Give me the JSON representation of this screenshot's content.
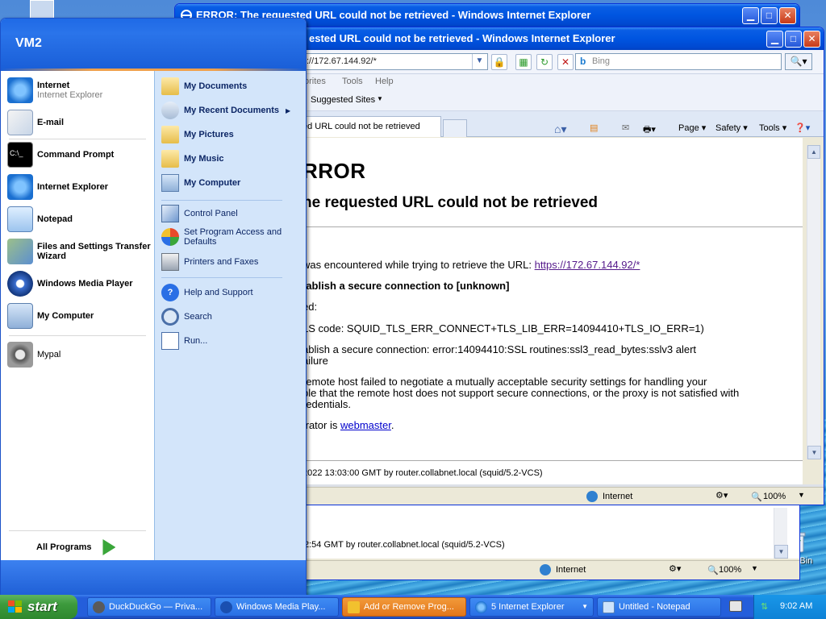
{
  "desktop": {
    "recycle_label": "ycle Bin"
  },
  "ie_back": {
    "title": "ERROR: The requested URL could not be retrieved - Windows Internet Explorer",
    "footer_line": "2:54 GMT by router.collabnet.local (squid/5.2-VCS)",
    "zone": "Internet",
    "zoom": "100%"
  },
  "ie_front": {
    "title": "ERROR: The requested URL could not be retrieved - Windows Internet Explorer",
    "title_visible": "ested URL could not be retrieved - Windows Internet Explorer",
    "address": "://172.67.144.92/*",
    "search_placeholder": "Bing",
    "menu": [
      "orites",
      "Tools",
      "Help"
    ],
    "favorites": {
      "suggested": "Suggested Sites"
    },
    "tab_label": "ed URL could not be retrieved",
    "commands": {
      "page": "Page",
      "safety": "Safety",
      "tools": "Tools"
    },
    "page": {
      "h1": "RROR",
      "h2": "he requested URL could not be retrieved",
      "p1_prefix": " was encountered while trying to retrieve the URL: ",
      "p1_link": "https://172.67.144.92/*",
      "p2": "tablish a secure connection to [unknown]",
      "p3": "ed:",
      "p4": "LS code: SQUID_TLS_ERR_CONNECT+TLS_LIB_ERR=14094410+TLS_IO_ERR=1)",
      "p5a": "ablish a secure connection: error:14094410:SSL routines:ssl3_read_bytes:sslv3 alert",
      "p5b": "ailure",
      "p6a": "remote host failed to negotiate a mutually acceptable security settings for handling your",
      "p6b": "ble that the remote host does not support secure connections, or the proxy is not satisfied with",
      "p6c": "redentials.",
      "p7_prefix": "trator is ",
      "p7_link": "webmaster",
      "p7_suffix": ".",
      "footer_line": "2022 13:03:00 GMT by router.collabnet.local (squid/5.2-VCS)"
    },
    "zone": "Internet",
    "zoom": "100%"
  },
  "start_menu": {
    "user": "VM2",
    "pinned": [
      {
        "title": "Internet",
        "subtitle": "Internet Explorer"
      },
      {
        "title": "E-mail",
        "subtitle": ""
      }
    ],
    "recent": [
      "Command Prompt",
      "Internet Explorer",
      "Notepad",
      "Files and Settings Transfer Wizard",
      "Windows Media Player",
      "My Computer"
    ],
    "other": "Mypal",
    "all_programs": "All Programs",
    "right": {
      "my_documents": "My Documents",
      "my_recent_documents": "My Recent Documents",
      "my_pictures": "My Pictures",
      "my_music": "My Music",
      "my_computer": "My Computer",
      "control_panel": "Control Panel",
      "set_program_access": "Set Program Access and Defaults",
      "printers_faxes": "Printers and Faxes",
      "help_support": "Help and Support",
      "search": "Search",
      "run": "Run..."
    }
  },
  "taskbar": {
    "start": "start",
    "buttons": [
      "DuckDuckGo — Priva...",
      "Windows Media Play...",
      "Add or Remove Prog...",
      "5 Internet Explorer",
      "Untitled - Notepad"
    ],
    "clock": "9:02 AM"
  },
  "colors": {
    "xp_blue": "#245edb",
    "start_green": "#3c9a3c",
    "active_orange": "#e2761a",
    "link_visited": "#551a8b",
    "link": "#0000cc"
  }
}
